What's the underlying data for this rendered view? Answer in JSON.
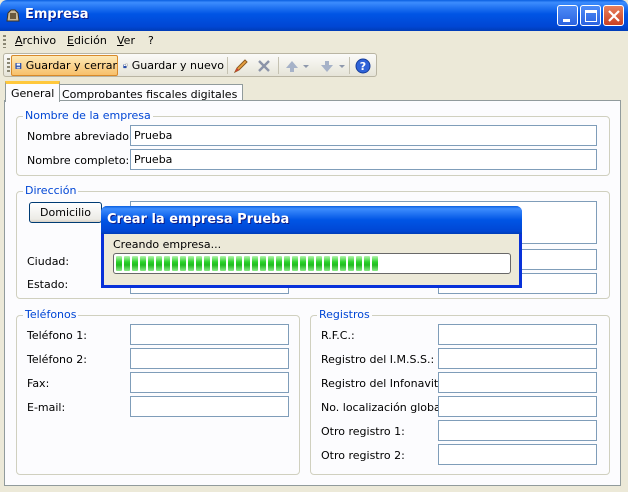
{
  "window": {
    "title": "Empresa",
    "icon": "app-icon"
  },
  "menu": {
    "items": [
      "Archivo",
      "Edición",
      "Ver",
      "?"
    ]
  },
  "toolbar": {
    "save_close_label": "Guardar y cerrar",
    "save_new_label": "Guardar y nuevo",
    "icons": [
      "save-icon",
      "save-new-icon",
      "edit-icon",
      "delete-icon",
      "up-icon",
      "dropdown-icon",
      "down-icon",
      "dropdown-icon",
      "help-icon"
    ]
  },
  "tabs": [
    "General",
    "Comprobantes fiscales digitales"
  ],
  "company": {
    "title": "Nombre de la empresa",
    "short_name_label": "Nombre abreviado:",
    "short_name_value": "Prueba",
    "full_name_label": "Nombre completo:",
    "full_name_value": "Prueba"
  },
  "address": {
    "title": "Dirección",
    "domicilio_button": "Domicilio",
    "city_label": "Ciudad:",
    "state_label": "Estado:"
  },
  "phones": {
    "title": "Teléfonos",
    "phone1_label": "Teléfono 1:",
    "phone2_label": "Teléfono 2:",
    "fax_label": "Fax:",
    "email_label": "E-mail:"
  },
  "registros": {
    "title": "Registros",
    "rfc_label": "R.F.C.:",
    "imss_label": "Registro del I.M.S.S.:",
    "infonavit_label": "Registro del Infonavit:",
    "gln_label": "No. localización global:",
    "other1_label": "Otro registro 1:",
    "other2_label": "Otro registro 2:"
  },
  "progress_dialog": {
    "title": "Crear la empresa Prueba",
    "message": "Creando empresa...",
    "progress": 0.68
  },
  "colors": {
    "title_bar": "#0055E5",
    "group_title": "#0046D5",
    "progress_fill": "#21BC1F",
    "active_tool": "#F7C06B"
  }
}
